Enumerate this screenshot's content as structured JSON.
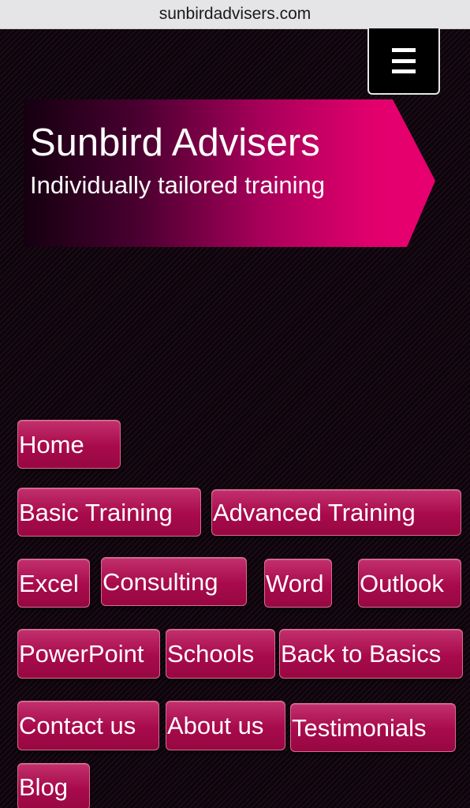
{
  "browser": {
    "url": "sunbirdadvisers.com"
  },
  "header": {
    "menu_icon": "hamburger-menu-icon",
    "title": "Sunbird Advisers",
    "tagline": "Individually tailored training"
  },
  "nav": {
    "items": [
      {
        "label": "Home"
      },
      {
        "label": "Basic Training"
      },
      {
        "label": "Advanced Training"
      },
      {
        "label": "Excel"
      },
      {
        "label": "Consulting"
      },
      {
        "label": "Word"
      },
      {
        "label": "Outlook"
      },
      {
        "label": "PowerPoint"
      },
      {
        "label": "Schools"
      },
      {
        "label": "Back to Basics"
      },
      {
        "label": "Contact us"
      },
      {
        "label": "About us"
      },
      {
        "label": "Testimonials"
      },
      {
        "label": "Blog"
      }
    ]
  },
  "colors": {
    "background": "#0f050d",
    "accent": "#e2006d",
    "button": "#a80a4c"
  }
}
